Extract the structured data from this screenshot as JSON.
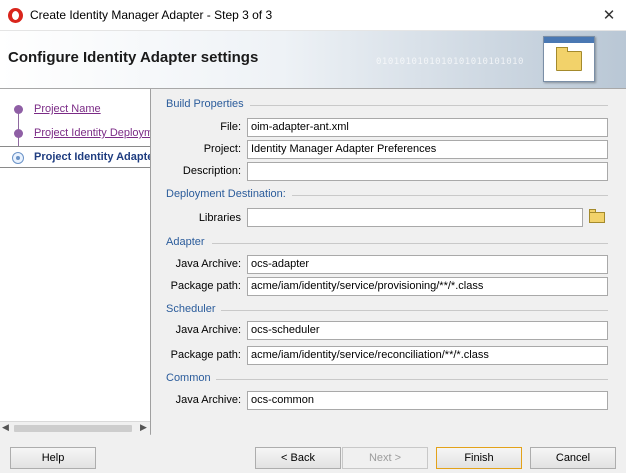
{
  "window": {
    "title": "Create Identity Manager Adapter - Step 3 of 3",
    "close_symbol": "✕"
  },
  "banner": {
    "heading": "Configure Identity Adapter settings",
    "binary_text": "0101010101010101010101010"
  },
  "nav": {
    "steps": [
      {
        "label": "Project Name",
        "state": "done"
      },
      {
        "label": "Project Identity Deployment",
        "state": "done"
      },
      {
        "label": "Project Identity Adapter",
        "state": "current"
      }
    ]
  },
  "build": {
    "section": "Build Properties",
    "file_label": "File:",
    "file_value": "oim-adapter-ant.xml",
    "project_label": "Project:",
    "project_value": "Identity Manager Adapter Preferences",
    "description_label": "Description:",
    "description_value": ""
  },
  "deployment": {
    "section": "Deployment Destination:",
    "libraries_label": "Libraries",
    "libraries_value": ""
  },
  "adapter": {
    "section": "Adapter",
    "archive_label": "Java Archive:",
    "archive_value": "ocs-adapter",
    "package_label": "Package path:",
    "package_value": "acme/iam/identity/service/provisioning/**/*.class"
  },
  "scheduler": {
    "section": "Scheduler",
    "archive_label": "Java Archive:",
    "archive_value": "ocs-scheduler",
    "package_label": "Package path:",
    "package_value": "acme/iam/identity/service/reconciliation/**/*.class"
  },
  "common": {
    "section": "Common",
    "archive_label": "Java Archive:",
    "archive_value": "ocs-common"
  },
  "buttons": {
    "help": "Help",
    "back": "< Back",
    "next": "Next >",
    "finish": "Finish",
    "cancel": "Cancel"
  },
  "colors": {
    "section_header": "#2b5c9b",
    "visited_link": "#7b2b86",
    "current_step": "#1f3d80",
    "default_button_border": "#e3a21a"
  },
  "icons": [
    "app-logo-icon",
    "close-icon",
    "wizard-folder-icon",
    "browse-folder-icon"
  ]
}
